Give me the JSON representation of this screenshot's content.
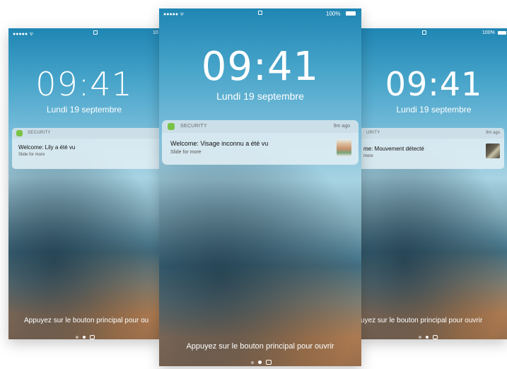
{
  "phones": {
    "left": {
      "status": {
        "signal": "●●●●● ᯤ",
        "battery_pct": "10"
      },
      "time": "09:41",
      "date": "Lundi 19 septembre",
      "notification": {
        "app": "SECURITY",
        "title": "Welcome: Lily a été vu",
        "subtitle": "Slide for more"
      },
      "bottom_text": "Appuyez sur le bouton principal pour ou"
    },
    "center": {
      "status": {
        "signal": "●●●●● ᯤ",
        "battery_pct": "100%"
      },
      "time": "09:41",
      "date": "Lundi 19 septembre",
      "notification": {
        "app": "SECURITY",
        "time_ago": "9m ago",
        "title": "Welcome: Visage inconnu a été vu",
        "subtitle": "Slide for more"
      },
      "bottom_text": "Appuyez sur le bouton principal pour ouvrir"
    },
    "right": {
      "status": {
        "battery_pct": "100%"
      },
      "time": "09:41",
      "date": "Lundi 19 septembre",
      "notification": {
        "app": "URITY",
        "time_ago": "9m ago",
        "title": "me: Mouvement détecté",
        "subtitle": "more"
      },
      "bottom_text": "uyez sur le bouton principal pour ouvrir"
    }
  },
  "colors": {
    "app_icon": "#79c246",
    "notification_bg": "#e1eef4"
  }
}
